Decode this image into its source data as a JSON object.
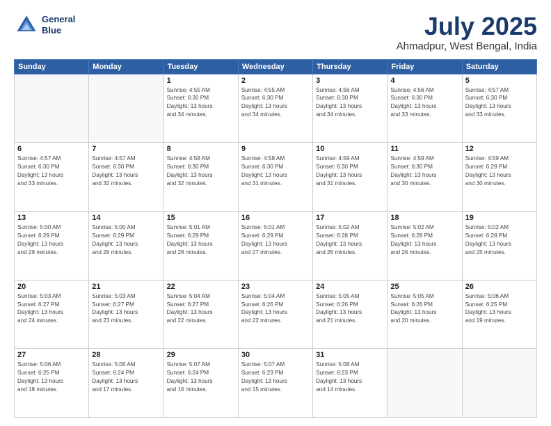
{
  "header": {
    "logo_line1": "General",
    "logo_line2": "Blue",
    "title": "July 2025",
    "subtitle": "Ahmadpur, West Bengal, India"
  },
  "weekdays": [
    "Sunday",
    "Monday",
    "Tuesday",
    "Wednesday",
    "Thursday",
    "Friday",
    "Saturday"
  ],
  "weeks": [
    [
      {
        "day": "",
        "info": ""
      },
      {
        "day": "",
        "info": ""
      },
      {
        "day": "1",
        "info": "Sunrise: 4:55 AM\nSunset: 6:30 PM\nDaylight: 13 hours\nand 34 minutes."
      },
      {
        "day": "2",
        "info": "Sunrise: 4:55 AM\nSunset: 6:30 PM\nDaylight: 13 hours\nand 34 minutes."
      },
      {
        "day": "3",
        "info": "Sunrise: 4:56 AM\nSunset: 6:30 PM\nDaylight: 13 hours\nand 34 minutes."
      },
      {
        "day": "4",
        "info": "Sunrise: 4:56 AM\nSunset: 6:30 PM\nDaylight: 13 hours\nand 33 minutes."
      },
      {
        "day": "5",
        "info": "Sunrise: 4:57 AM\nSunset: 6:30 PM\nDaylight: 13 hours\nand 33 minutes."
      }
    ],
    [
      {
        "day": "6",
        "info": "Sunrise: 4:57 AM\nSunset: 6:30 PM\nDaylight: 13 hours\nand 33 minutes."
      },
      {
        "day": "7",
        "info": "Sunrise: 4:57 AM\nSunset: 6:30 PM\nDaylight: 13 hours\nand 32 minutes."
      },
      {
        "day": "8",
        "info": "Sunrise: 4:58 AM\nSunset: 6:30 PM\nDaylight: 13 hours\nand 32 minutes."
      },
      {
        "day": "9",
        "info": "Sunrise: 4:58 AM\nSunset: 6:30 PM\nDaylight: 13 hours\nand 31 minutes."
      },
      {
        "day": "10",
        "info": "Sunrise: 4:59 AM\nSunset: 6:30 PM\nDaylight: 13 hours\nand 31 minutes."
      },
      {
        "day": "11",
        "info": "Sunrise: 4:59 AM\nSunset: 6:30 PM\nDaylight: 13 hours\nand 30 minutes."
      },
      {
        "day": "12",
        "info": "Sunrise: 4:59 AM\nSunset: 6:29 PM\nDaylight: 13 hours\nand 30 minutes."
      }
    ],
    [
      {
        "day": "13",
        "info": "Sunrise: 5:00 AM\nSunset: 6:29 PM\nDaylight: 13 hours\nand 29 minutes."
      },
      {
        "day": "14",
        "info": "Sunrise: 5:00 AM\nSunset: 6:29 PM\nDaylight: 13 hours\nand 28 minutes."
      },
      {
        "day": "15",
        "info": "Sunrise: 5:01 AM\nSunset: 6:29 PM\nDaylight: 13 hours\nand 28 minutes."
      },
      {
        "day": "16",
        "info": "Sunrise: 5:01 AM\nSunset: 6:29 PM\nDaylight: 13 hours\nand 27 minutes."
      },
      {
        "day": "17",
        "info": "Sunrise: 5:02 AM\nSunset: 6:28 PM\nDaylight: 13 hours\nand 26 minutes."
      },
      {
        "day": "18",
        "info": "Sunrise: 5:02 AM\nSunset: 6:28 PM\nDaylight: 13 hours\nand 26 minutes."
      },
      {
        "day": "19",
        "info": "Sunrise: 5:02 AM\nSunset: 6:28 PM\nDaylight: 13 hours\nand 25 minutes."
      }
    ],
    [
      {
        "day": "20",
        "info": "Sunrise: 5:03 AM\nSunset: 6:27 PM\nDaylight: 13 hours\nand 24 minutes."
      },
      {
        "day": "21",
        "info": "Sunrise: 5:03 AM\nSunset: 6:27 PM\nDaylight: 13 hours\nand 23 minutes."
      },
      {
        "day": "22",
        "info": "Sunrise: 5:04 AM\nSunset: 6:27 PM\nDaylight: 13 hours\nand 22 minutes."
      },
      {
        "day": "23",
        "info": "Sunrise: 5:04 AM\nSunset: 6:26 PM\nDaylight: 13 hours\nand 22 minutes."
      },
      {
        "day": "24",
        "info": "Sunrise: 5:05 AM\nSunset: 6:26 PM\nDaylight: 13 hours\nand 21 minutes."
      },
      {
        "day": "25",
        "info": "Sunrise: 5:05 AM\nSunset: 6:26 PM\nDaylight: 13 hours\nand 20 minutes."
      },
      {
        "day": "26",
        "info": "Sunrise: 5:06 AM\nSunset: 6:25 PM\nDaylight: 13 hours\nand 19 minutes."
      }
    ],
    [
      {
        "day": "27",
        "info": "Sunrise: 5:06 AM\nSunset: 6:25 PM\nDaylight: 13 hours\nand 18 minutes."
      },
      {
        "day": "28",
        "info": "Sunrise: 5:06 AM\nSunset: 6:24 PM\nDaylight: 13 hours\nand 17 minutes."
      },
      {
        "day": "29",
        "info": "Sunrise: 5:07 AM\nSunset: 6:24 PM\nDaylight: 13 hours\nand 16 minutes."
      },
      {
        "day": "30",
        "info": "Sunrise: 5:07 AM\nSunset: 6:23 PM\nDaylight: 13 hours\nand 15 minutes."
      },
      {
        "day": "31",
        "info": "Sunrise: 5:08 AM\nSunset: 6:23 PM\nDaylight: 13 hours\nand 14 minutes."
      },
      {
        "day": "",
        "info": ""
      },
      {
        "day": "",
        "info": ""
      }
    ]
  ]
}
